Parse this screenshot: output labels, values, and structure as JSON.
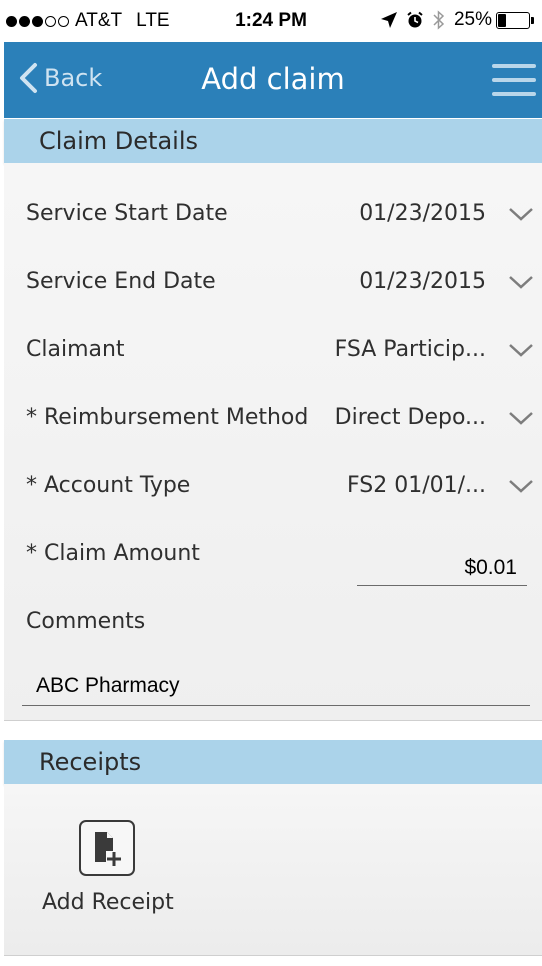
{
  "status_bar": {
    "carrier": "AT&T",
    "network": "LTE",
    "time": "1:24 PM",
    "battery_text": "25%",
    "battery_level": 0.25,
    "signal_bars": 3,
    "signal_total": 5
  },
  "nav": {
    "back_label": "Back",
    "title": "Add claim",
    "menu_icon": "hamburger-icon",
    "color": "#2b80b9"
  },
  "claim_details": {
    "header": "Claim Details",
    "fields": [
      {
        "label": "Service Start Date",
        "value": "01/23/2015"
      },
      {
        "label": "Service End Date",
        "value": "01/23/2015"
      },
      {
        "label": "Claimant",
        "value": "FSA Particip..."
      },
      {
        "label": "* Reimbursement Method",
        "value": "Direct Depo..."
      },
      {
        "label": "* Account Type",
        "value": "FS2 01/01/..."
      }
    ],
    "amount_label": "* Claim Amount",
    "amount_value": "$0.01",
    "comments_label": "Comments",
    "comments_value": "ABC Pharmacy"
  },
  "receipts": {
    "header": "Receipts",
    "add_label": "Add Receipt",
    "add_icon": "add-document-icon"
  },
  "colors": {
    "section_header": "#abd3ea",
    "panel_bg": "#f2f2f2"
  }
}
